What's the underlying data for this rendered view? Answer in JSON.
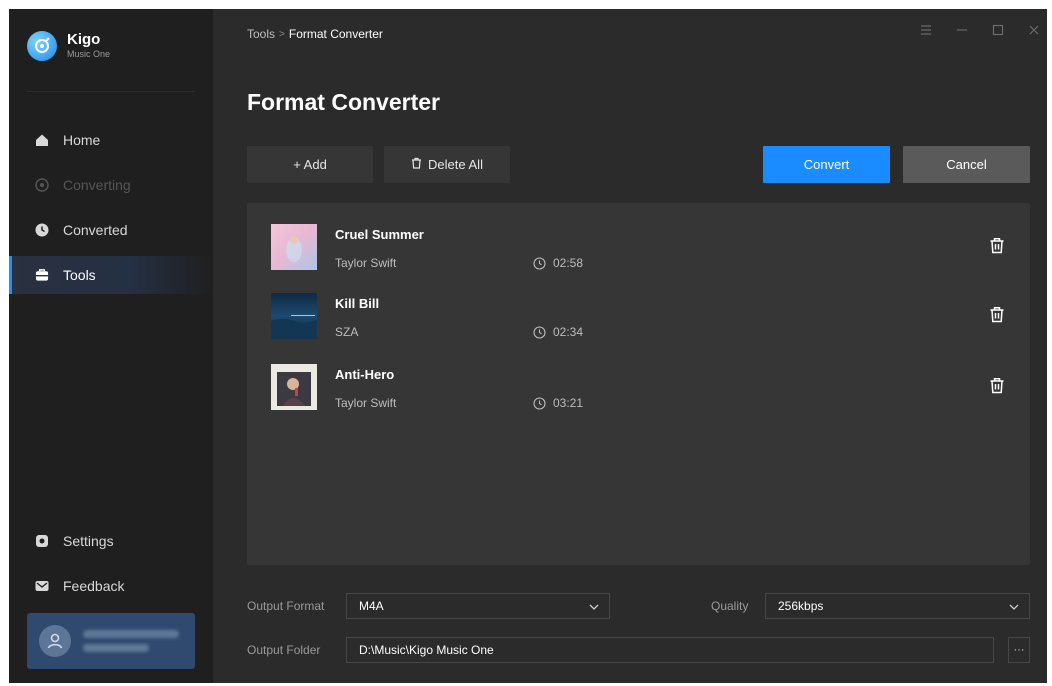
{
  "app": {
    "name": "Kigo",
    "subtitle": "Music One"
  },
  "sidebar": {
    "items": [
      {
        "label": "Home",
        "icon": "home-icon",
        "state": "normal"
      },
      {
        "label": "Converting",
        "icon": "converting-icon",
        "state": "disabled"
      },
      {
        "label": "Converted",
        "icon": "clock-icon",
        "state": "normal"
      },
      {
        "label": "Tools",
        "icon": "toolbox-icon",
        "state": "active"
      }
    ],
    "bottom_items": [
      {
        "label": "Settings",
        "icon": "gear-icon"
      },
      {
        "label": "Feedback",
        "icon": "mail-icon"
      }
    ]
  },
  "breadcrumb": {
    "parent": "Tools",
    "separator": ">",
    "current": "Format Converter"
  },
  "page": {
    "title": "Format Converter"
  },
  "toolbar": {
    "add_label": "+ Add",
    "delete_all_label": "Delete All",
    "convert_label": "Convert",
    "cancel_label": "Cancel"
  },
  "songs": [
    {
      "title": "Cruel Summer",
      "artist": "Taylor Swift",
      "duration": "02:58"
    },
    {
      "title": "Kill Bill",
      "artist": "SZA",
      "duration": "02:34"
    },
    {
      "title": "Anti-Hero",
      "artist": "Taylor Swift",
      "duration": "03:21"
    }
  ],
  "output": {
    "format_label": "Output Format",
    "format_value": "M4A",
    "quality_label": "Quality",
    "quality_value": "256kbps",
    "folder_label": "Output Folder",
    "folder_value": "D:\\Music\\Kigo Music One",
    "more_label": "···"
  },
  "colors": {
    "accent": "#1a8cff",
    "sidebar_bg": "#1f1f1f",
    "main_bg": "#2b2b2b",
    "panel_bg": "#363636",
    "active_nav_bg": "#243043"
  }
}
